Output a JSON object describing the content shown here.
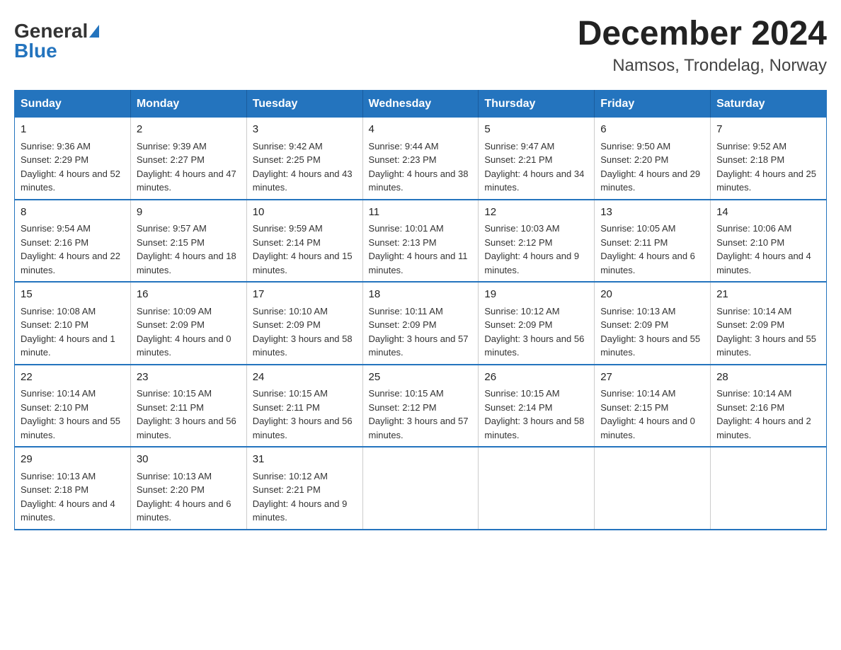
{
  "logo": {
    "general": "General",
    "blue": "Blue"
  },
  "title": "December 2024",
  "subtitle": "Namsos, Trondelag, Norway",
  "days_of_week": [
    "Sunday",
    "Monday",
    "Tuesday",
    "Wednesday",
    "Thursday",
    "Friday",
    "Saturday"
  ],
  "weeks": [
    [
      {
        "day": "1",
        "sunrise": "9:36 AM",
        "sunset": "2:29 PM",
        "daylight": "4 hours and 52 minutes."
      },
      {
        "day": "2",
        "sunrise": "9:39 AM",
        "sunset": "2:27 PM",
        "daylight": "4 hours and 47 minutes."
      },
      {
        "day": "3",
        "sunrise": "9:42 AM",
        "sunset": "2:25 PM",
        "daylight": "4 hours and 43 minutes."
      },
      {
        "day": "4",
        "sunrise": "9:44 AM",
        "sunset": "2:23 PM",
        "daylight": "4 hours and 38 minutes."
      },
      {
        "day": "5",
        "sunrise": "9:47 AM",
        "sunset": "2:21 PM",
        "daylight": "4 hours and 34 minutes."
      },
      {
        "day": "6",
        "sunrise": "9:50 AM",
        "sunset": "2:20 PM",
        "daylight": "4 hours and 29 minutes."
      },
      {
        "day": "7",
        "sunrise": "9:52 AM",
        "sunset": "2:18 PM",
        "daylight": "4 hours and 25 minutes."
      }
    ],
    [
      {
        "day": "8",
        "sunrise": "9:54 AM",
        "sunset": "2:16 PM",
        "daylight": "4 hours and 22 minutes."
      },
      {
        "day": "9",
        "sunrise": "9:57 AM",
        "sunset": "2:15 PM",
        "daylight": "4 hours and 18 minutes."
      },
      {
        "day": "10",
        "sunrise": "9:59 AM",
        "sunset": "2:14 PM",
        "daylight": "4 hours and 15 minutes."
      },
      {
        "day": "11",
        "sunrise": "10:01 AM",
        "sunset": "2:13 PM",
        "daylight": "4 hours and 11 minutes."
      },
      {
        "day": "12",
        "sunrise": "10:03 AM",
        "sunset": "2:12 PM",
        "daylight": "4 hours and 9 minutes."
      },
      {
        "day": "13",
        "sunrise": "10:05 AM",
        "sunset": "2:11 PM",
        "daylight": "4 hours and 6 minutes."
      },
      {
        "day": "14",
        "sunrise": "10:06 AM",
        "sunset": "2:10 PM",
        "daylight": "4 hours and 4 minutes."
      }
    ],
    [
      {
        "day": "15",
        "sunrise": "10:08 AM",
        "sunset": "2:10 PM",
        "daylight": "4 hours and 1 minute."
      },
      {
        "day": "16",
        "sunrise": "10:09 AM",
        "sunset": "2:09 PM",
        "daylight": "4 hours and 0 minutes."
      },
      {
        "day": "17",
        "sunrise": "10:10 AM",
        "sunset": "2:09 PM",
        "daylight": "3 hours and 58 minutes."
      },
      {
        "day": "18",
        "sunrise": "10:11 AM",
        "sunset": "2:09 PM",
        "daylight": "3 hours and 57 minutes."
      },
      {
        "day": "19",
        "sunrise": "10:12 AM",
        "sunset": "2:09 PM",
        "daylight": "3 hours and 56 minutes."
      },
      {
        "day": "20",
        "sunrise": "10:13 AM",
        "sunset": "2:09 PM",
        "daylight": "3 hours and 55 minutes."
      },
      {
        "day": "21",
        "sunrise": "10:14 AM",
        "sunset": "2:09 PM",
        "daylight": "3 hours and 55 minutes."
      }
    ],
    [
      {
        "day": "22",
        "sunrise": "10:14 AM",
        "sunset": "2:10 PM",
        "daylight": "3 hours and 55 minutes."
      },
      {
        "day": "23",
        "sunrise": "10:15 AM",
        "sunset": "2:11 PM",
        "daylight": "3 hours and 56 minutes."
      },
      {
        "day": "24",
        "sunrise": "10:15 AM",
        "sunset": "2:11 PM",
        "daylight": "3 hours and 56 minutes."
      },
      {
        "day": "25",
        "sunrise": "10:15 AM",
        "sunset": "2:12 PM",
        "daylight": "3 hours and 57 minutes."
      },
      {
        "day": "26",
        "sunrise": "10:15 AM",
        "sunset": "2:14 PM",
        "daylight": "3 hours and 58 minutes."
      },
      {
        "day": "27",
        "sunrise": "10:14 AM",
        "sunset": "2:15 PM",
        "daylight": "4 hours and 0 minutes."
      },
      {
        "day": "28",
        "sunrise": "10:14 AM",
        "sunset": "2:16 PM",
        "daylight": "4 hours and 2 minutes."
      }
    ],
    [
      {
        "day": "29",
        "sunrise": "10:13 AM",
        "sunset": "2:18 PM",
        "daylight": "4 hours and 4 minutes."
      },
      {
        "day": "30",
        "sunrise": "10:13 AM",
        "sunset": "2:20 PM",
        "daylight": "4 hours and 6 minutes."
      },
      {
        "day": "31",
        "sunrise": "10:12 AM",
        "sunset": "2:21 PM",
        "daylight": "4 hours and 9 minutes."
      },
      null,
      null,
      null,
      null
    ]
  ],
  "labels": {
    "sunrise": "Sunrise:",
    "sunset": "Sunset:",
    "daylight": "Daylight:"
  }
}
